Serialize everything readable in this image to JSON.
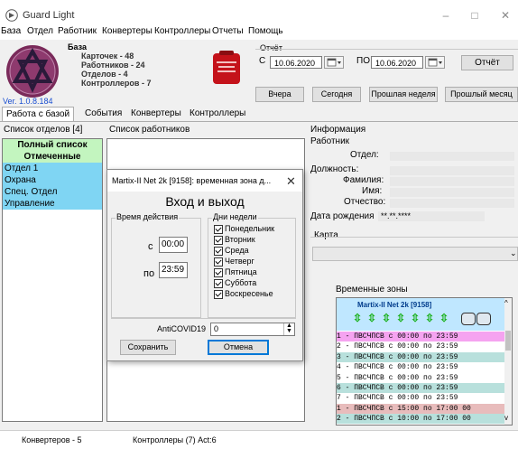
{
  "window": {
    "title": "Guard Light",
    "minimize": "–",
    "maximize": "□",
    "close": "✕"
  },
  "menu": [
    "База",
    "Отдел",
    "Работник",
    "Конвертеры",
    "Контроллеры",
    "Отчеты",
    "Помощь"
  ],
  "db_info": {
    "title": "База",
    "lines": [
      "Карточек - 48",
      "Работников - 24",
      "Отделов - 4",
      "Контроллеров - 7"
    ],
    "version": "Ver. 1.0.8.184"
  },
  "report": {
    "label": "Отчёт",
    "from_label": "С",
    "from_date": "10.06.2020",
    "to_label": "ПО",
    "to_date": "10.06.2020",
    "report_button": "Отчёт",
    "quick_buttons": [
      "Вчера",
      "Сегодня",
      "Прошлая неделя",
      "Прошлый месяц"
    ]
  },
  "tabs": [
    "Работа с базой",
    "События",
    "Конвертеры",
    "Контроллеры"
  ],
  "departments": {
    "label": "Список отделов [4]",
    "items": [
      {
        "text": "Полный список",
        "bg": "#c3f5bf",
        "bold": true,
        "center": true
      },
      {
        "text": "Отмеченные",
        "bg": "#c3f5bf",
        "bold": true,
        "center": true
      },
      {
        "text": "Отдел 1",
        "bg": "#7fd5f3",
        "bold": false,
        "center": false
      },
      {
        "text": "Охрана",
        "bg": "#7fd5f3",
        "bold": false,
        "center": false
      },
      {
        "text": "Спец. Отдел",
        "bg": "#7fd5f3",
        "bold": false,
        "center": false
      },
      {
        "text": "Управление",
        "bg": "#7fd5f3",
        "bold": false,
        "center": false
      }
    ]
  },
  "employees": {
    "label": "Список работников"
  },
  "info": {
    "label": "Информация",
    "worker_label": "Работник",
    "fields": [
      "Отдел:",
      "Должность:",
      "Фамилия:",
      "Имя:",
      "Отчество:"
    ],
    "birth_label": "Дата рождения",
    "birth_value": "**.**.****",
    "card_label": "Карта",
    "zones_label": "Временные зоны"
  },
  "zones": {
    "controller": "Martix-II Net 2k [9158]",
    "rows": [
      {
        "text": "1 - ПВСЧПСВ с 00:00 по 23:59",
        "bg": "#f5a3f0"
      },
      {
        "text": "2 - ПВСЧПСВ с 00:00 по 23:59",
        "bg": "#ffffff"
      },
      {
        "text": "3 - ПВСЧПСВ с 00:00 по 23:59",
        "bg": "#b8e0dc"
      },
      {
        "text": "4 - ПВСЧПСВ с 00:00 по 23:59",
        "bg": "#ffffff"
      },
      {
        "text": "5 - ПВСЧПСВ с 00:00 по 23:59",
        "bg": "#ffffff"
      },
      {
        "text": "6 - ПВСЧПСВ с 00:00 по 23:59",
        "bg": "#b8e0dc"
      },
      {
        "text": "7 - ПВСЧПСВ с 00:00 по 23:59",
        "bg": "#ffffff"
      },
      {
        "text": "1 - ПВСЧПСВ с 15:00 по 17:00 00",
        "bg": "#e8bcbc"
      },
      {
        "text": "2 - ПВСЧПСВ с 10:00 по 17:00 00",
        "bg": "#b8e0dc"
      }
    ]
  },
  "dialog": {
    "title": "Martix-II Net 2k [9158]: временная зона д...",
    "close": "✕",
    "heading": "Вход и выход",
    "time_group": "Время действия",
    "from_label": "с",
    "from_value": "00:00",
    "to_label": "по",
    "to_value": "23:59",
    "days_group": "Дни недели",
    "days": [
      "Понедельник",
      "Вторник",
      "Среда",
      "Четверг",
      "Пятница",
      "Суббота",
      "Воскресенье"
    ],
    "param_label": "AntiCOVID19",
    "param_value": "0",
    "save": "Сохранить",
    "cancel": "Отмена"
  },
  "status": [
    "Конвертеров - 5",
    "Контроллеры (7) Act:6"
  ],
  "colors": {
    "accent": "#0078d7",
    "logo": "#7a2a5a",
    "red_icon": "#c4121a"
  }
}
